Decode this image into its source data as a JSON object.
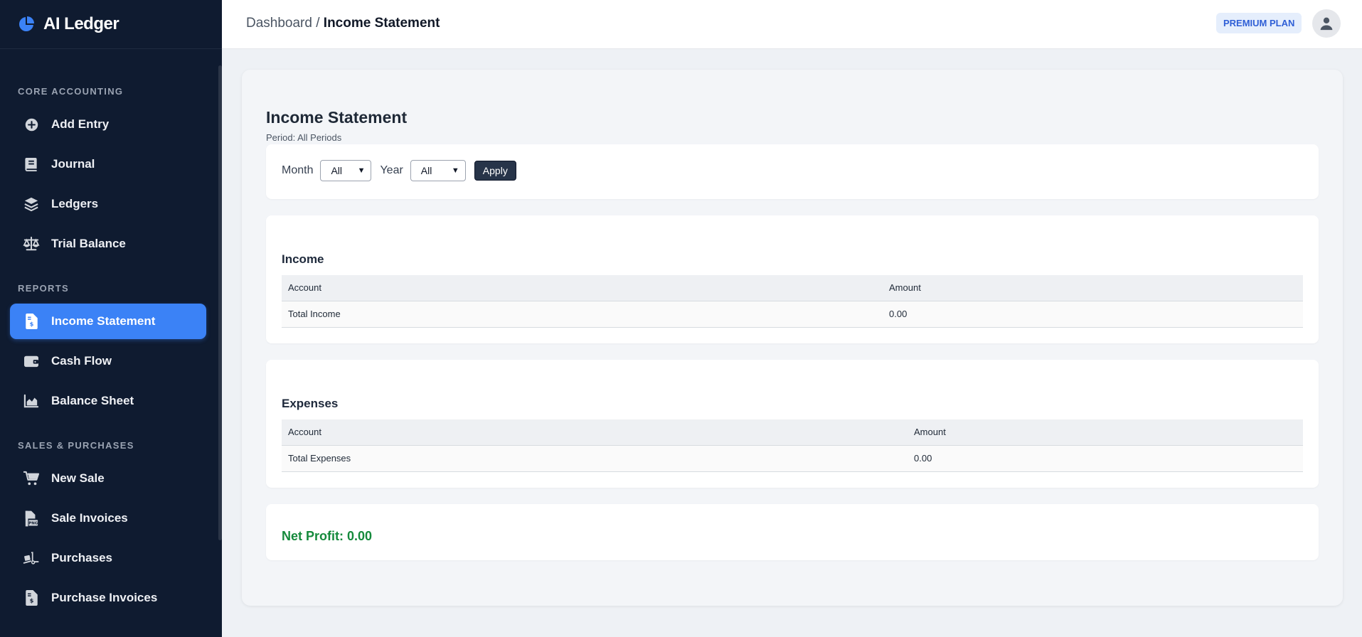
{
  "app": {
    "name": "AI Ledger"
  },
  "sidebar": {
    "sections": [
      {
        "label": "CORE ACCOUNTING",
        "items": [
          {
            "label": "Add Entry",
            "icon": "plus-circle-icon"
          },
          {
            "label": "Journal",
            "icon": "book-icon"
          },
          {
            "label": "Ledgers",
            "icon": "layers-icon"
          },
          {
            "label": "Trial Balance",
            "icon": "scale-icon"
          }
        ]
      },
      {
        "label": "REPORTS",
        "items": [
          {
            "label": "Income Statement",
            "icon": "invoice-dollar-icon",
            "active": true
          },
          {
            "label": "Cash Flow",
            "icon": "wallet-icon"
          },
          {
            "label": "Balance Sheet",
            "icon": "chart-area-icon"
          }
        ]
      },
      {
        "label": "SALES & PURCHASES",
        "items": [
          {
            "label": "New Sale",
            "icon": "cart-icon"
          },
          {
            "label": "Sale Invoices",
            "icon": "file-png-icon"
          },
          {
            "label": "Purchases",
            "icon": "truck-ramp-icon"
          },
          {
            "label": "Purchase Invoices",
            "icon": "file-dollar-icon"
          }
        ]
      }
    ]
  },
  "header": {
    "breadcrumb_root": "Dashboard",
    "breadcrumb_sep": " / ",
    "breadcrumb_current": "Income Statement",
    "plan_badge": "PREMIUM PLAN"
  },
  "report": {
    "title": "Income Statement",
    "period": "Period: All Periods",
    "filters": {
      "month_label": "Month",
      "month_value": "All",
      "year_label": "Year",
      "year_value": "All",
      "apply_label": "Apply"
    },
    "income": {
      "title": "Income",
      "col_account": "Account",
      "col_amount": "Amount",
      "total_label": "Total Income",
      "total_value": "0.00"
    },
    "expenses": {
      "title": "Expenses",
      "col_account": "Account",
      "col_amount": "Amount",
      "total_label": "Total Expenses",
      "total_value": "0.00"
    },
    "net_profit": "Net Profit: 0.00"
  },
  "colors": {
    "sidebar_bg": "#0f1b30",
    "accent": "#3b82f6",
    "profit": "#158a3c"
  }
}
